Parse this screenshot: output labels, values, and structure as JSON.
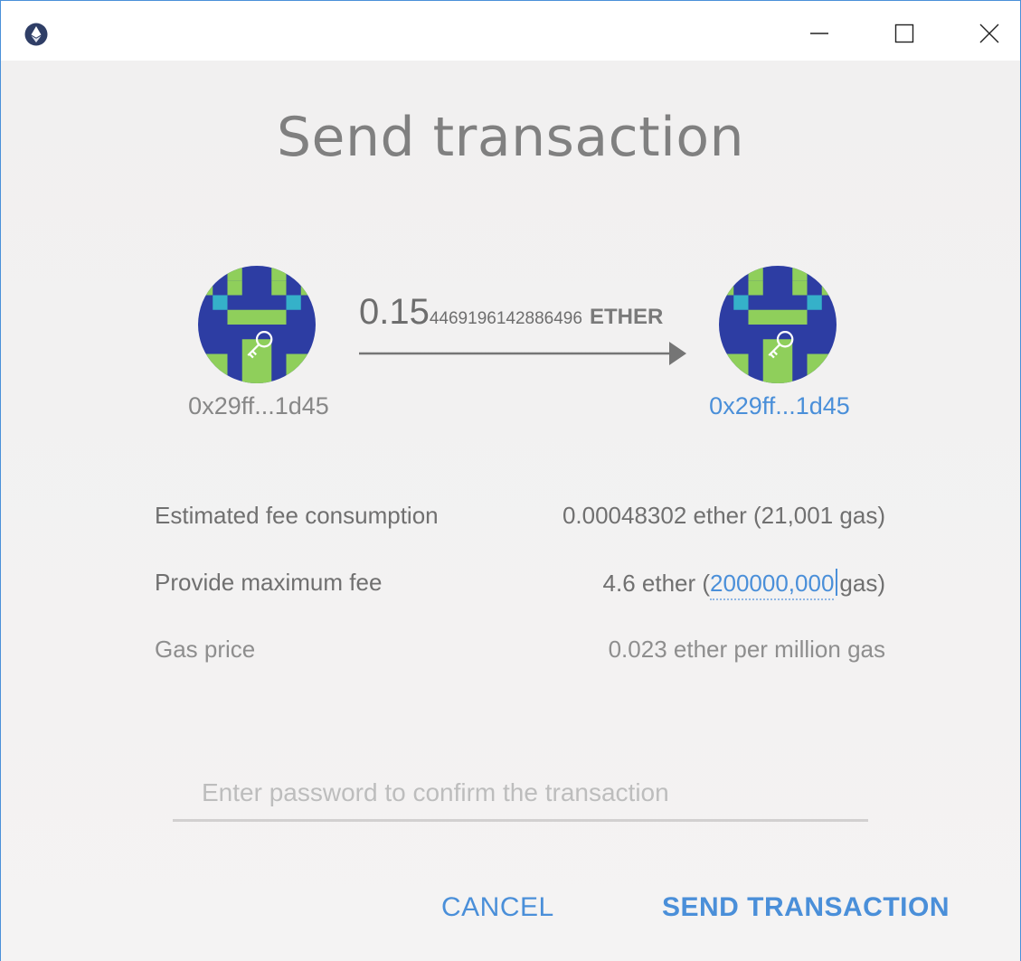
{
  "window": {
    "app_icon": "ethereum-icon",
    "controls": [
      "minimize-icon",
      "maximize-icon",
      "close-icon"
    ]
  },
  "title": "Send transaction",
  "transfer": {
    "from": {
      "address": "0x29ff...1d45",
      "avatar": "identicon-key-icon"
    },
    "to": {
      "address": "0x29ff...1d45",
      "avatar": "identicon-key-icon"
    },
    "amount_major": "0.15",
    "amount_minor": "4469196142886496",
    "unit": "ETHER"
  },
  "fees": {
    "estimated_label": "Estimated fee consumption",
    "estimated_value": "0.00048302 ether (21,001 gas)",
    "max_label": "Provide maximum fee",
    "max_value_prefix": "4.6 ether (",
    "max_gas": "200000,000",
    "max_value_suffix": "gas)",
    "price_label": "Gas price",
    "price_value": "0.023 ether per million gas"
  },
  "password": {
    "placeholder": "Enter password to confirm the transaction",
    "value": ""
  },
  "actions": {
    "cancel": "CANCEL",
    "send": "SEND TRANSACTION"
  },
  "colors": {
    "accent": "#4a8fd9",
    "text": "#707070",
    "background": "#f3f2f2"
  }
}
